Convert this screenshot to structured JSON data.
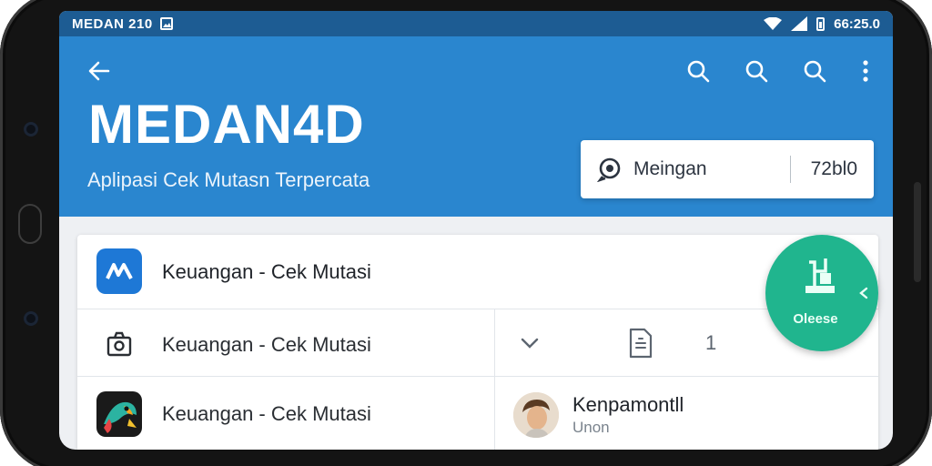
{
  "status_bar": {
    "left_text": "MEDAN 210",
    "time": "66:25.0"
  },
  "app_bar": {
    "title": "MEDAN4D",
    "subtitle": "Aplipasi Cek Mutasn Terpercata"
  },
  "search": {
    "label": "Meingan",
    "count": "72bl0"
  },
  "list": {
    "row1": {
      "label": "Keuangan - Cek Mutasi"
    },
    "row2": {
      "label": "Keuangan - Cek Mutasi",
      "count": "1"
    },
    "row3": {
      "label": "Keuangan - Cek Mutasi"
    }
  },
  "user": {
    "name": "Kenpamontll",
    "sub": "Unon"
  },
  "fab": {
    "label": "Oleese"
  },
  "colors": {
    "primary": "#2a86cf",
    "status_bar": "#1d5c93",
    "fab": "#20b58e",
    "app_icon": "#1e78d6"
  },
  "icons": [
    "back-arrow-icon",
    "search-icon",
    "more-vert-icon",
    "chat-search-icon",
    "camera-icon",
    "chevron-down-icon",
    "document-icon",
    "parrot-app-icon",
    "wifi-icon",
    "signal-icon",
    "battery-icon"
  ]
}
